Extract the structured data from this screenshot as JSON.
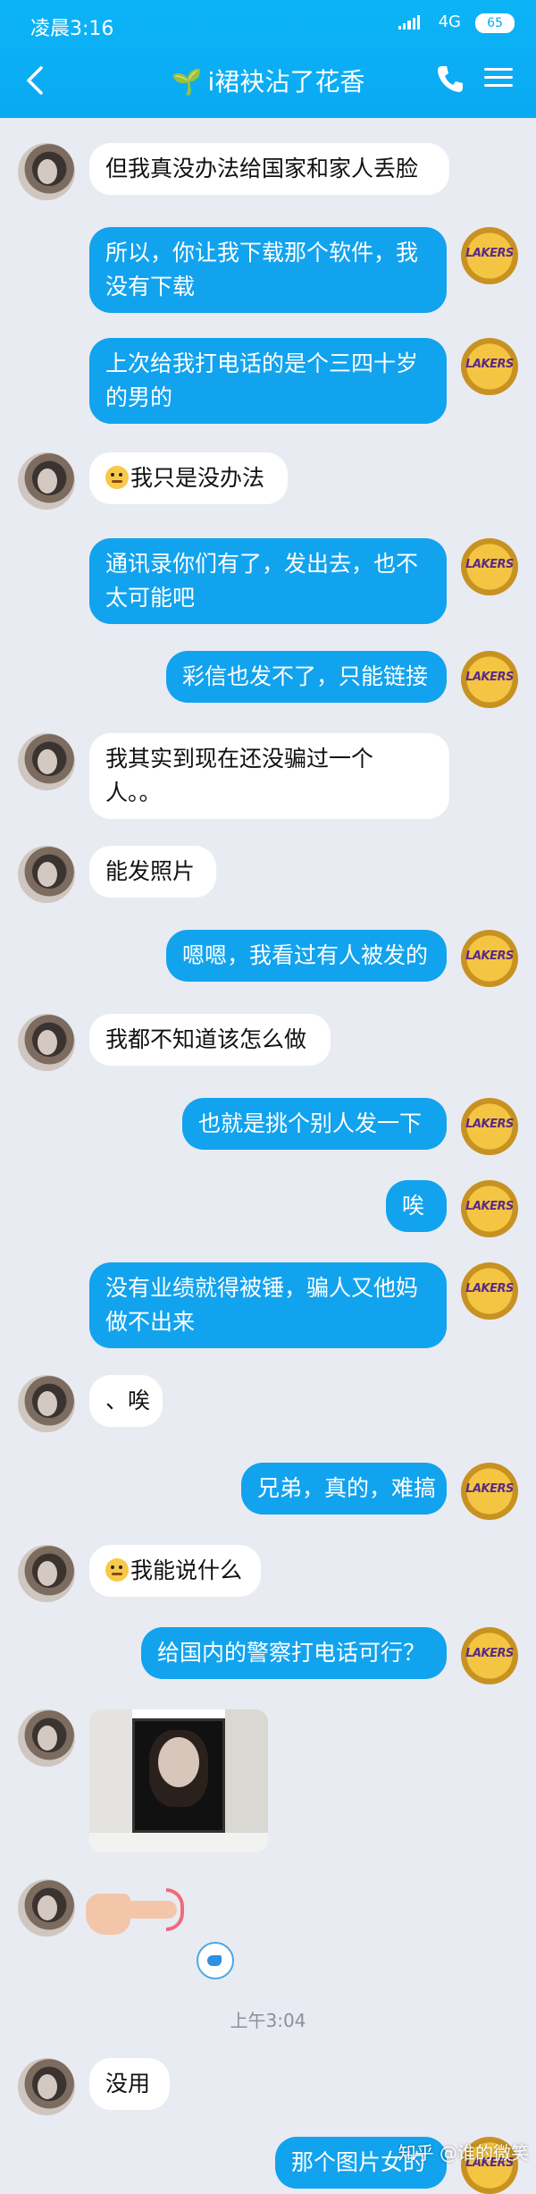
{
  "status_bar": {
    "time": "凌晨3:16",
    "network": "4G",
    "battery": "65"
  },
  "header": {
    "title": "i裙袂沾了花香",
    "sprout": "🌱"
  },
  "messages": [
    {
      "side": "left",
      "text": "但我真没办法给国家和家人丢脸"
    },
    {
      "side": "right",
      "line1": "所以，你让我下载那个软件，我",
      "line2": "没有下载"
    },
    {
      "side": "right",
      "line1": "上次给我打电话的是个三四十岁",
      "line2": "的男的"
    },
    {
      "side": "left",
      "text": "我只是没办法",
      "emoji": "emoji-thinking"
    },
    {
      "side": "right",
      "line1": "通讯录你们有了，发出去，也不",
      "line2": "太可能吧"
    },
    {
      "side": "right",
      "text": "彩信也发不了，只能链接"
    },
    {
      "side": "left",
      "line1": "我其实到现在还没骗过一个",
      "line2": "人。。"
    },
    {
      "side": "left",
      "text": "能发照片"
    },
    {
      "side": "right",
      "text": "嗯嗯，我看过有人被发的"
    },
    {
      "side": "left",
      "text": "我都不知道该怎么做"
    },
    {
      "side": "right",
      "text": "也就是挑个别人发一下"
    },
    {
      "side": "right",
      "text": "唉"
    },
    {
      "side": "right",
      "line1": "没有业绩就得被锤，骗人又他妈",
      "line2": "做不出来"
    },
    {
      "side": "left",
      "text": "、唉"
    },
    {
      "side": "right",
      "text": "兄弟，真的，难搞"
    },
    {
      "side": "left",
      "text": "我能说什么",
      "emoji": "emoji-thinking"
    },
    {
      "side": "right",
      "text": "给国内的警察打电话可行？"
    },
    {
      "side": "right",
      "text": "那个图片女的"
    }
  ],
  "lakers_text": "LAKERS",
  "timestamp": "上午3:04",
  "last_left": "没用",
  "watermark": "知乎 @谁的微笑"
}
